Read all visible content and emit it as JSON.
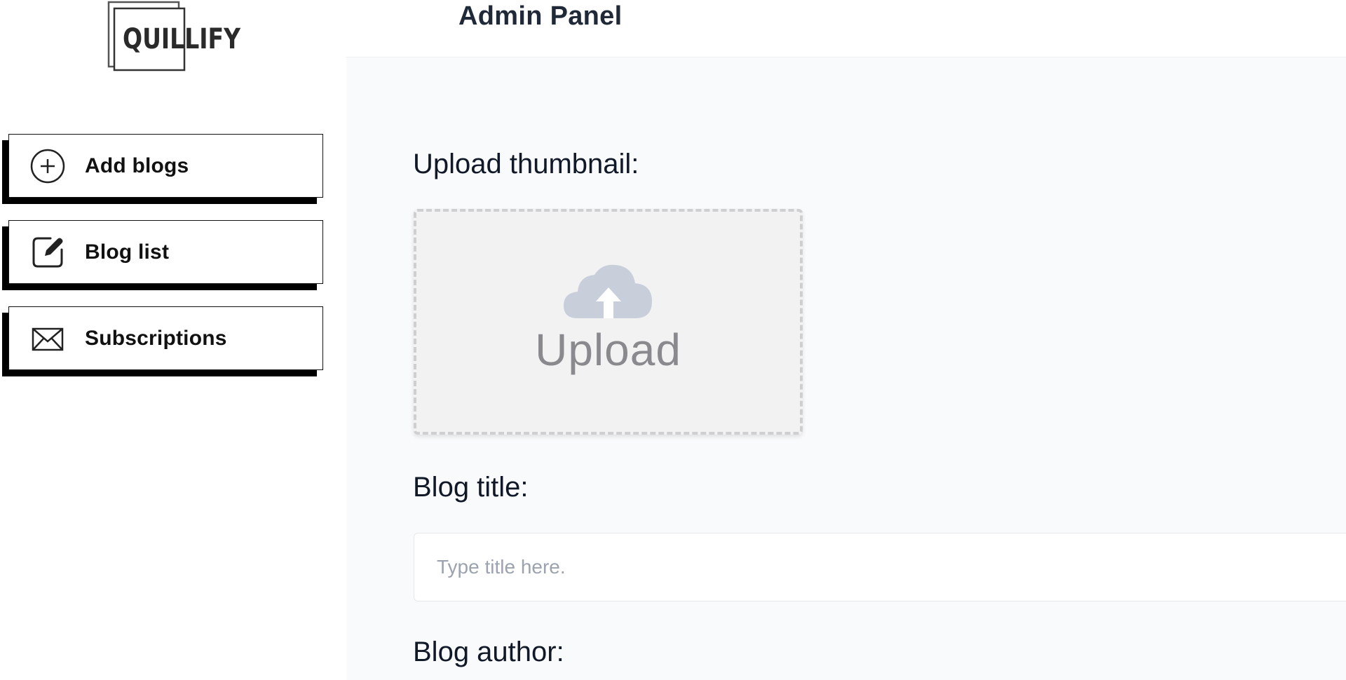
{
  "logo": {
    "text": "QUILLIFY"
  },
  "header": {
    "title": "Admin Panel"
  },
  "sidebar": {
    "items": [
      {
        "label": "Add blogs",
        "icon": "plus-circle-icon"
      },
      {
        "label": "Blog list",
        "icon": "edit-icon"
      },
      {
        "label": "Subscriptions",
        "icon": "mail-icon"
      }
    ]
  },
  "form": {
    "thumbnail_label": "Upload thumbnail:",
    "upload_text": "Upload",
    "upload_icon": "cloud-upload-icon",
    "title_label": "Blog title:",
    "title_placeholder": "Type title here.",
    "title_value": "",
    "author_label": "Blog author:"
  },
  "colors": {
    "accent": "#000000",
    "main_bg": "#f9fafb",
    "upload_box_bg": "#f2f2f3",
    "cloud": "#c9cedb",
    "text": "#1f2937"
  }
}
